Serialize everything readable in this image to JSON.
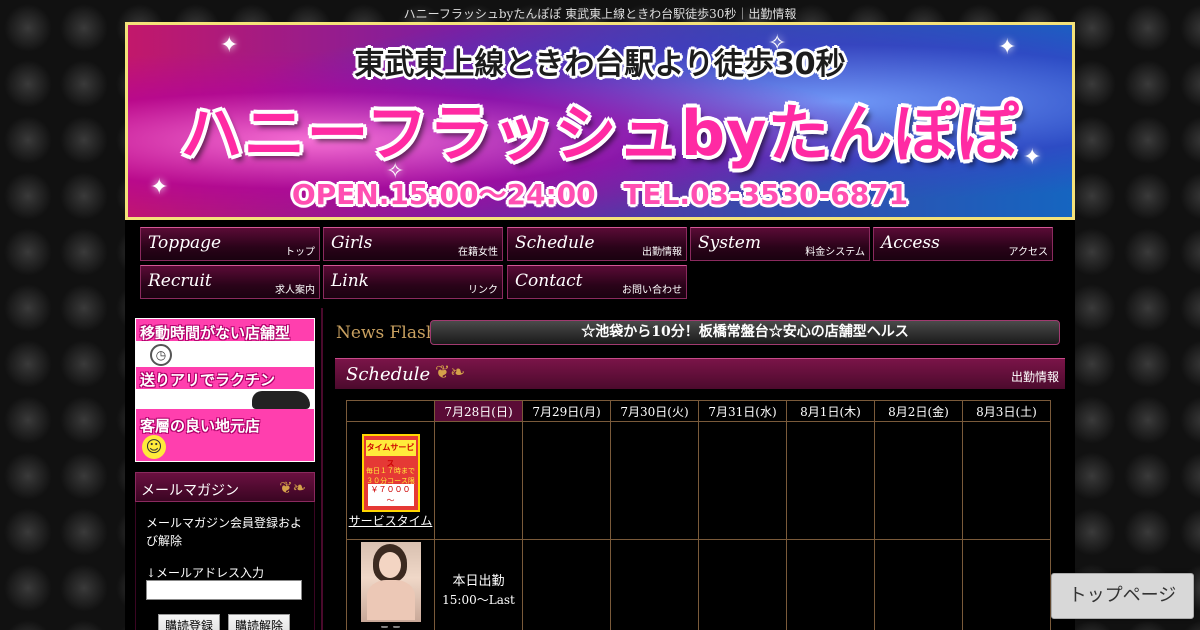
{
  "page": {
    "title": "ハニーフラッシュbyたんぽぽ 東武東上線ときわ台駅徒歩30秒｜出勤情報"
  },
  "banner": {
    "line1": "東武東上線ときわ台駅より徒歩30秒",
    "line2": "ハニーフラッシュbyたんぽぽ",
    "line3": "OPEN.15:00～24:00 TEL.03-3530-6871"
  },
  "nav": {
    "items": [
      {
        "en": "Toppage",
        "ja": "トップ"
      },
      {
        "en": "Girls",
        "ja": "在籍女性"
      },
      {
        "en": "Schedule",
        "ja": "出勤情報"
      },
      {
        "en": "System",
        "ja": "料金システム"
      },
      {
        "en": "Access",
        "ja": "アクセス"
      },
      {
        "en": "Recruit",
        "ja": "求人案内"
      },
      {
        "en": "Link",
        "ja": "リンク"
      },
      {
        "en": "Contact",
        "ja": "お問い合わせ"
      }
    ]
  },
  "side_ad": {
    "line1": "移動時間がない店舗型",
    "line2": "送りアリでラクチン",
    "line3": "客層の良い地元店"
  },
  "mail": {
    "heading": "メールマガジン",
    "description": "メールマガジン会員登録および解除",
    "address_label": "↓メールアドレス入力",
    "address_value": "",
    "subscribe_label": "購読登録",
    "unsubscribe_label": "購読解除"
  },
  "news": {
    "label": "News Flash",
    "text": "☆池袋から10分！板橋常盤台☆安心の店舗型ヘルス"
  },
  "schedule": {
    "heading_en": "Schedule",
    "heading_ja": "出勤情報",
    "dates": [
      "7月28日(日)",
      "7月29日(月)",
      "7月30日(火)",
      "7月31日(水)",
      "8月1日(木)",
      "8月2日(金)",
      "8月3日(土)"
    ],
    "rows": [
      {
        "name": "サービスタイム",
        "thumb_type": "ad",
        "thumb_text": {
          "top": "タイムサービス",
          "mid": "毎日１７時まで ３０分コース限定",
          "price": "￥７０００～"
        },
        "cells": [
          "",
          "",
          "",
          "",
          "",
          "",
          ""
        ]
      },
      {
        "name": "ここ",
        "thumb_type": "girl",
        "cells": [
          {
            "status": "本日出勤",
            "time": "15:00～Last"
          },
          "",
          "",
          "",
          "",
          "",
          ""
        ]
      }
    ]
  },
  "toppage_button": "トップページ"
}
